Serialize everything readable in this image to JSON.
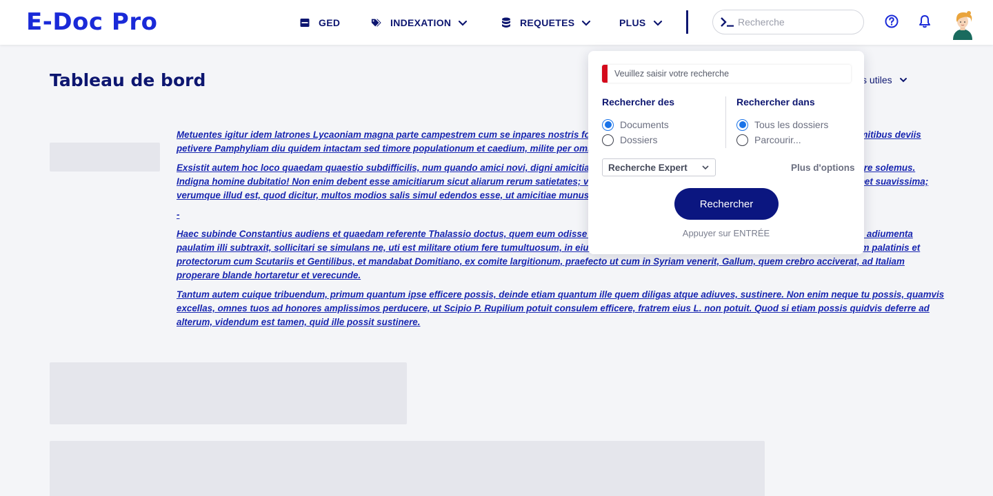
{
  "app": {
    "logo": "E-Doc Pro"
  },
  "nav": {
    "items": [
      {
        "label": "GED",
        "icon": "archive-box-icon",
        "has_dropdown": false
      },
      {
        "label": "INDEXATION",
        "icon": "tags-icon",
        "has_dropdown": true
      },
      {
        "label": "REQUETES",
        "icon": "database-icon",
        "has_dropdown": true
      },
      {
        "label": "PLUS",
        "icon": "",
        "has_dropdown": true
      }
    ]
  },
  "header": {
    "search_placeholder": "Recherche",
    "icons": [
      "terminal-prompt-icon",
      "help-circle-icon",
      "bell-icon",
      "avatar"
    ]
  },
  "page": {
    "title": "Tableau de bord",
    "info_link": "Informations utiles",
    "paragraphs": [
      "Metuentes igitur idem latrones Lycaoniam magna parte campestrem cum se inpares nostris fore congressione stataria documentis frequentibus scirent, tramitibus deviis petivere Pamphyliam diu quidem intactam sed timore populationum et caedium, milite per omnia diffuso propinqua, magnis undique praesidiis conmunitam.",
      "Exsistit autem hoc loco quaedam quaestio subdifficilis, num quando amici novi, digni amicitia, veteribus sint anteponendi, ut equis vetulis teneros anteponere solemus. Indigna homine dubitatio! Non enim debent esse amicitiarum sicut aliarum rerum satietates; veterrima quaeque, ut ea vina, quae vetustatem ferunt, esse debet suavissima; verumque illud est, quod dicitur, multos modios salis simul edendos esse, ut amicitiae munus expletum sit.",
      "-",
      "Haec subinde Constantius audiens et quaedam referente Thalassio doctus, quem eum odisse iam conpererat lege communi, scribens ad Caesarem blandius adiumenta paulatim illi subtraxit, sollicitari se simulans ne, uti est militare otium fere tumultuosum, in eius perniciem conspiraret, solisque scholis iussit esse contentum palatinis et protectorum cum Scutariis et Gentilibus, et mandabat Domitiano, ex comite largitionum, praefecto ut cum in Syriam venerit, Gallum, quem crebro acciverat, ad Italiam properare blande hortaretur et verecunde.",
      "Tantum autem cuique tribuendum, primum quantum ipse efficere possis, deinde etiam quantum ille quem diligas atque adiuves, sustinere. Non enim neque tu possis, quamvis excellas, omnes tuos ad honores amplissimos perducere, ut Scipio P. Rupilium potuit consulem efficere, fratrem eius L. non potuit. Quod si etiam possis quidvis deferre ad alterum, videndum est tamen, quid ille possit sustinere."
    ]
  },
  "search_popover": {
    "input_placeholder": "Veuillez saisir votre recherche",
    "search_for": {
      "heading": "Rechercher des",
      "options": [
        "Documents",
        "Dossiers"
      ],
      "selected": "Documents"
    },
    "search_in": {
      "heading": "Rechercher dans",
      "options": [
        "Tous les dossiers",
        "Parcourir..."
      ],
      "selected": "Tous les dossiers"
    },
    "mode_select": "Recherche Expert",
    "more_options": "Plus d'options",
    "submit_label": "Rechercher",
    "hint": "Appuyer sur ENTRÉE"
  },
  "colors": {
    "brand": "#1a2ad8",
    "navy": "#0d1670",
    "button": "#0b1680",
    "accent_red": "#d40a1c",
    "radio_blue": "#1a73e8",
    "link_text": "#1826b0"
  }
}
